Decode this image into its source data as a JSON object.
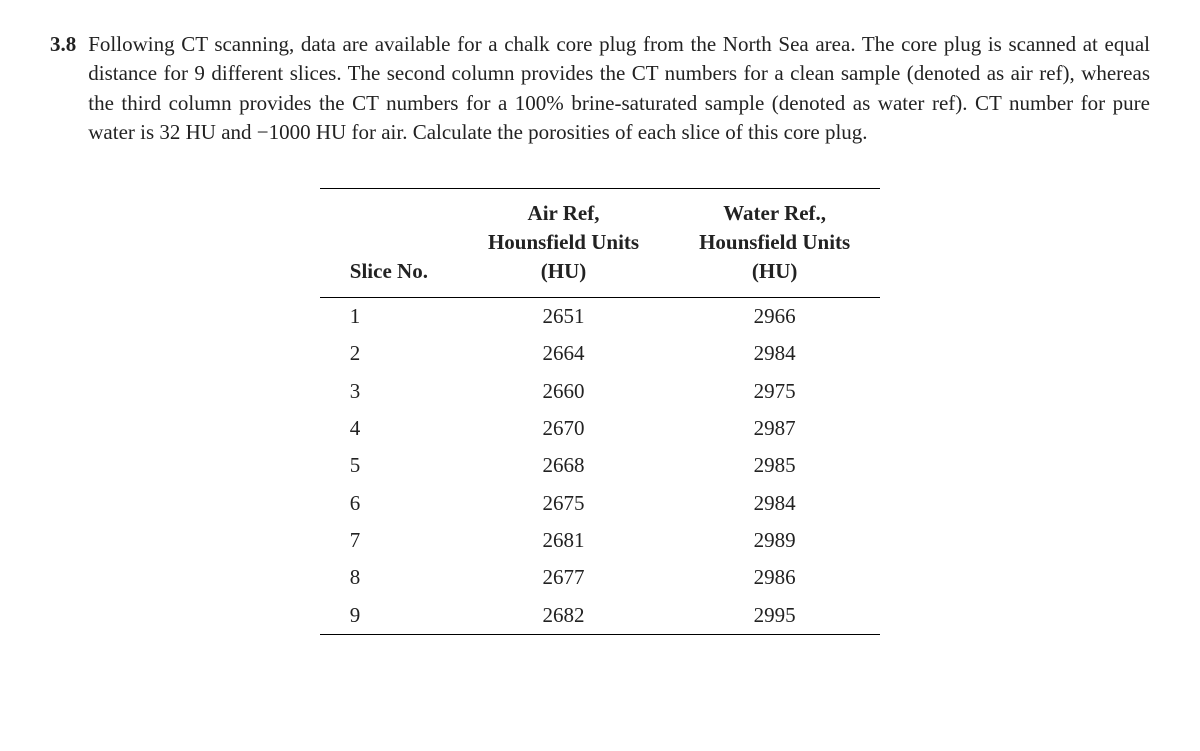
{
  "problem": {
    "number": "3.8",
    "text": "Following CT scanning, data are available for a chalk core plug from the North Sea area. The core plug is scanned at equal distance for 9 different slices. The second column provides the CT numbers for a clean sample (denoted as air ref), whereas the third column provides the CT numbers for a 100% brine-saturated sample (denoted as water ref). CT number for pure water is 32 HU and −1000 HU for air. Calculate the porosities of each slice of this core plug."
  },
  "table": {
    "headers": {
      "col1": "Slice No.",
      "col2_line1": "Air Ref,",
      "col2_line2": "Hounsfield Units",
      "col2_line3": "(HU)",
      "col3_line1": "Water Ref.,",
      "col3_line2": "Hounsfield Units",
      "col3_line3": "(HU)"
    },
    "rows": [
      {
        "slice": "1",
        "air": "2651",
        "water": "2966"
      },
      {
        "slice": "2",
        "air": "2664",
        "water": "2984"
      },
      {
        "slice": "3",
        "air": "2660",
        "water": "2975"
      },
      {
        "slice": "4",
        "air": "2670",
        "water": "2987"
      },
      {
        "slice": "5",
        "air": "2668",
        "water": "2985"
      },
      {
        "slice": "6",
        "air": "2675",
        "water": "2984"
      },
      {
        "slice": "7",
        "air": "2681",
        "water": "2989"
      },
      {
        "slice": "8",
        "air": "2677",
        "water": "2986"
      },
      {
        "slice": "9",
        "air": "2682",
        "water": "2995"
      }
    ]
  },
  "chart_data": {
    "type": "table",
    "columns": [
      "Slice No.",
      "Air Ref, Hounsfield Units (HU)",
      "Water Ref., Hounsfield Units (HU)"
    ],
    "rows": [
      [
        1,
        2651,
        2966
      ],
      [
        2,
        2664,
        2984
      ],
      [
        3,
        2660,
        2975
      ],
      [
        4,
        2670,
        2987
      ],
      [
        5,
        2668,
        2985
      ],
      [
        6,
        2675,
        2984
      ],
      [
        7,
        2681,
        2989
      ],
      [
        8,
        2677,
        2986
      ],
      [
        9,
        2682,
        2995
      ]
    ],
    "notes": "CT number for pure water is 32 HU and −1000 HU for air."
  }
}
